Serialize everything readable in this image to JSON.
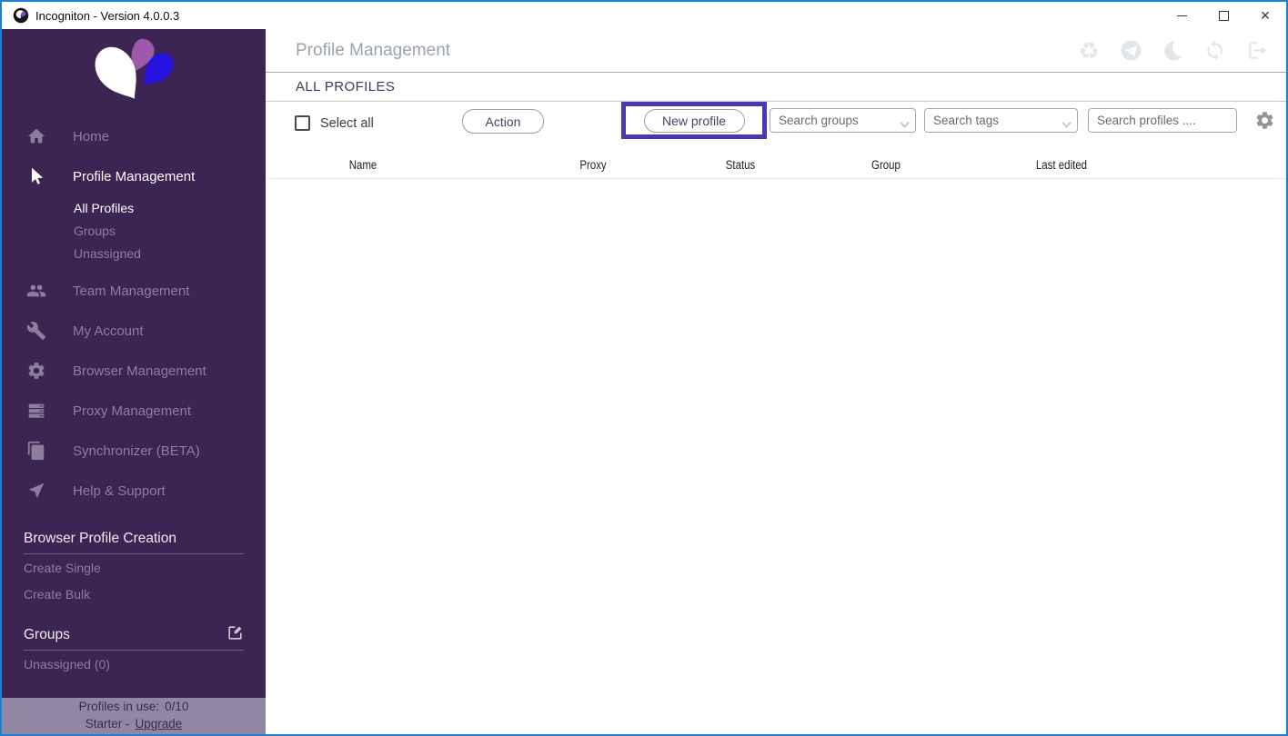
{
  "window": {
    "title": "Incogniton - Version 4.0.0.3",
    "close_glyph": "×"
  },
  "sidebar": {
    "nav": [
      {
        "label": "Home"
      },
      {
        "label": "Profile Management"
      },
      {
        "label": "Team Management"
      },
      {
        "label": "My Account"
      },
      {
        "label": "Browser Management"
      },
      {
        "label": "Proxy Management"
      },
      {
        "label": "Synchronizer (BETA)"
      },
      {
        "label": "Help & Support"
      }
    ],
    "profile_sub": [
      "All Profiles",
      "Groups",
      "Unassigned"
    ],
    "creation": {
      "heading": "Browser Profile Creation",
      "items": [
        "Create Single",
        "Create Bulk"
      ]
    },
    "groups": {
      "heading": "Groups",
      "items": [
        "Unassigned (0)"
      ]
    },
    "footer": {
      "usage_label": "Profiles in use:",
      "usage_value": "0/10",
      "plan_prefix": "Starter -",
      "upgrade_link": "Upgrade"
    }
  },
  "main": {
    "title": "Profile Management",
    "tab": "ALL PROFILES",
    "toolbar": {
      "select_all": "Select all",
      "action_button": "Action",
      "new_profile_button": "New profile",
      "search_groups_placeholder": "Search groups",
      "search_tags_placeholder": "Search tags",
      "search_profiles_placeholder": "Search profiles ...."
    },
    "table": {
      "columns": [
        "Name",
        "Proxy",
        "Status",
        "Group",
        "Last edited"
      ],
      "rows": []
    }
  },
  "colors": {
    "accent_highlight": "#4a38b2",
    "sidebar_bg": "#3c2453",
    "footer_bg": "#9187a3",
    "logo_purple": "#9c58aa",
    "logo_blue": "#2613dd",
    "window_border_blue": "#1a7fd6"
  }
}
